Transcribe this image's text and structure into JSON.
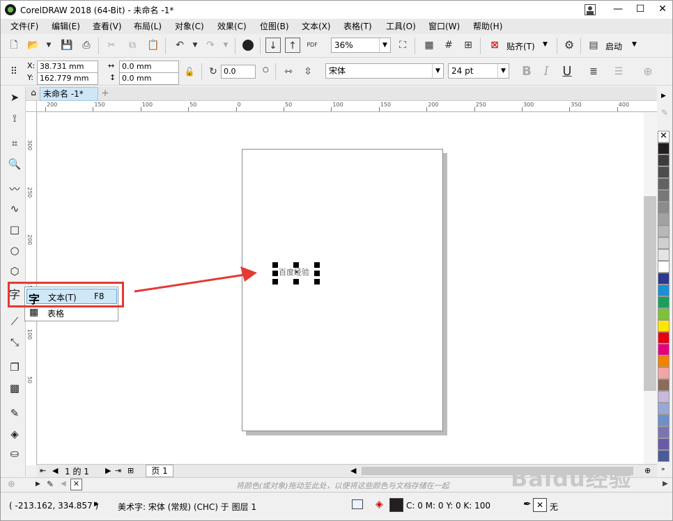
{
  "window": {
    "title": "CorelDRAW 2018 (64-Bit) - 未命名 -1*",
    "minimize": "—",
    "maximize": "☐",
    "close": "✕"
  },
  "menu": [
    "文件(F)",
    "编辑(E)",
    "查看(V)",
    "布局(L)",
    "对象(C)",
    "效果(C)",
    "位图(B)",
    "文本(X)",
    "表格(T)",
    "工具(O)",
    "窗口(W)",
    "帮助(H)"
  ],
  "toolbar": {
    "zoom": "36%",
    "snap_label": "贴齐(T)",
    "launch_label": "启动",
    "pdf_label": "PDF"
  },
  "property_bar": {
    "x_label": "X:",
    "x_value": "38.731 mm",
    "y_label": "Y:",
    "y_value": "162.779 mm",
    "w_value": "0.0 mm",
    "h_value": "0.0 mm",
    "rotation": "0.0",
    "font": "宋体",
    "font_size": "24 pt",
    "bold": "B",
    "italic": "I",
    "underline": "U"
  },
  "doc_tab": {
    "label": "未命名 -1*",
    "add": "+"
  },
  "ruler": {
    "h_ticks": [
      "200",
      "150",
      "100",
      "50",
      "0",
      "50",
      "100",
      "150",
      "200",
      "250",
      "300",
      "350",
      "400"
    ],
    "v_ticks": [
      "300",
      "250",
      "200",
      "150",
      "100",
      "50"
    ]
  },
  "canvas": {
    "text_object": "百度经验"
  },
  "text_tool_glyph": "字",
  "flyout": {
    "items": [
      {
        "label": "文本(T)",
        "shortcut": "F8"
      },
      {
        "label": "表格",
        "shortcut": ""
      }
    ]
  },
  "pagebar": {
    "page_of": "1 的 1",
    "page_tab": "页 1"
  },
  "docbar": {
    "hint": "将颜色(或对象)拖动至此处，以便将这些颜色与文档存储在一起"
  },
  "status": {
    "coords": "( -213.162, 334.857 )",
    "object_info": "美术字: 宋体 (常规) (CHC) 于 图层 1",
    "fill": "C: 0 M: 0 Y: 0 K: 100",
    "outline": "无"
  },
  "palette_colors": [
    "#231f20",
    "#3c3c3c",
    "#4d4d4d",
    "#626262",
    "#787878",
    "#8c8c8c",
    "#a2a2a2",
    "#b8b8b8",
    "#cfcfcf",
    "#e4e4e4",
    "#ffffff",
    "#2b3a8c",
    "#1a8fd4",
    "#1aa05a",
    "#7dc23a",
    "#ffe600",
    "#e60012",
    "#e4007f",
    "#f08300",
    "#f3a5a5",
    "#8c6b5a",
    "#c8b8dc",
    "#9aa8d8",
    "#6e8fc8",
    "#7b74b4",
    "#6c5aa8",
    "#4a5b9a"
  ],
  "watermark": "Baidu经验"
}
